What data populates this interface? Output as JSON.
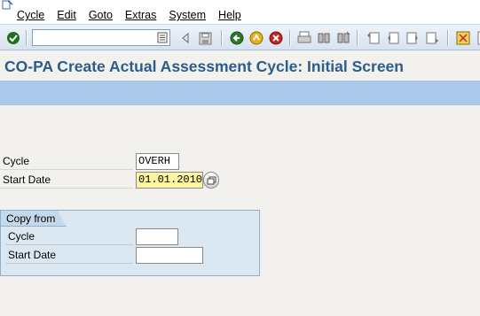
{
  "menu": [
    "Cycle",
    "Edit",
    "Goto",
    "Extras",
    "System",
    "Help"
  ],
  "toolbar": {
    "command_field_value": "",
    "icons": [
      "enter-icon",
      "dropdown-icon",
      "back-arrow-icon",
      "save-icon",
      "back-icon",
      "exit-icon",
      "cancel-icon",
      "print-icon",
      "find-icon",
      "find-next-icon",
      "first-page-icon",
      "previous-page-icon",
      "next-page-icon",
      "last-page-icon",
      "create-session-icon"
    ]
  },
  "title": "CO-PA Create Actual Assessment Cycle: Initial Screen",
  "form": {
    "cycle_label": "Cycle",
    "cycle_value": "OVERH",
    "start_date_label": "Start Date",
    "start_date_value": "01.01.2010"
  },
  "copy_from": {
    "title": "Copy from",
    "cycle_label": "Cycle",
    "cycle_value": "",
    "start_date_label": "Start Date",
    "start_date_value": ""
  },
  "colors": {
    "title": "#2b5d8c",
    "app_toolbar": "#a9c8ea",
    "focused_input": "#fdf5a0",
    "group_box": "#dbe8f1"
  }
}
